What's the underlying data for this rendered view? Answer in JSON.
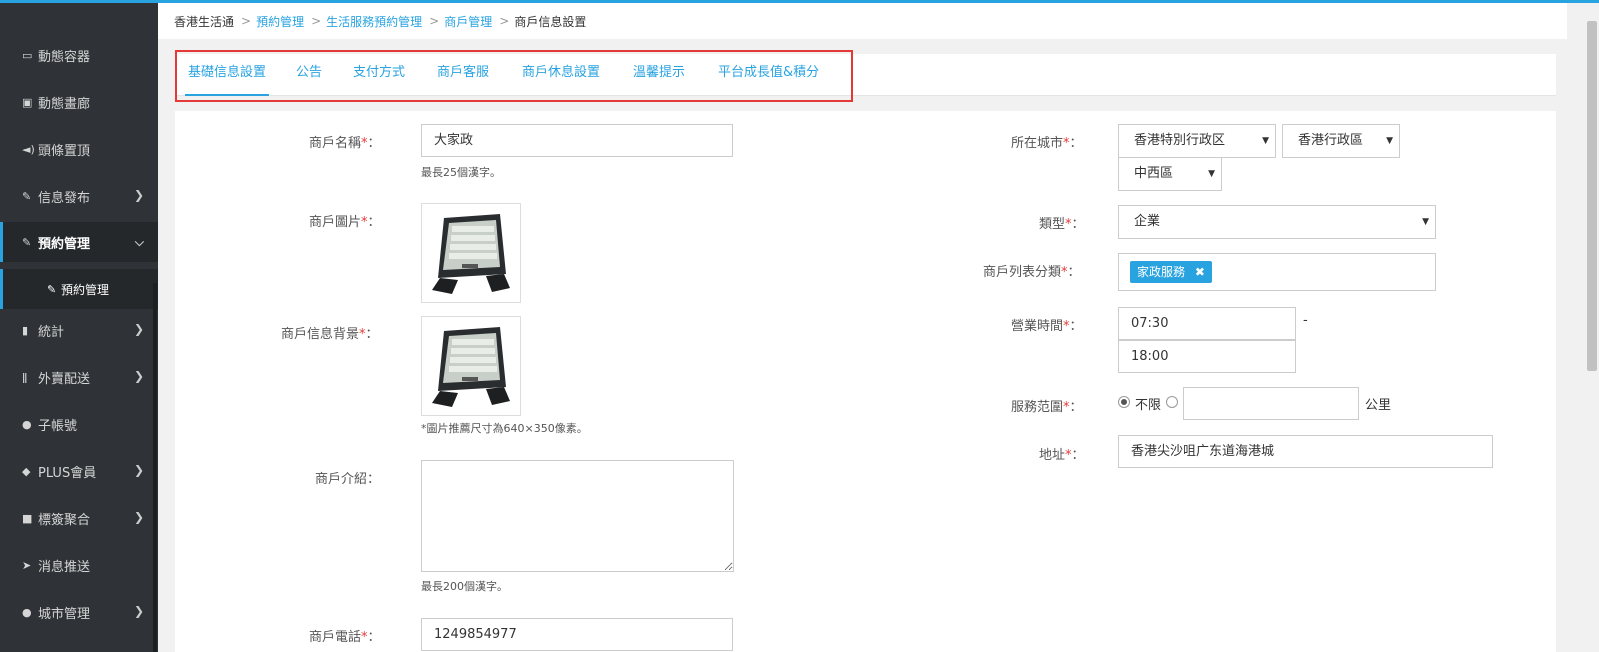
{
  "sidebar": {
    "items": [
      {
        "label": "動態容器",
        "icon": "tablet-icon",
        "glyph": "▭",
        "has_arrow": false
      },
      {
        "label": "動態畫廊",
        "icon": "image-icon",
        "glyph": "▣",
        "has_arrow": false
      },
      {
        "label": "頭條置頂",
        "icon": "megaphone-icon",
        "glyph": "◄)",
        "has_arrow": false
      },
      {
        "label": "信息發布",
        "icon": "edit-icon",
        "glyph": "✎",
        "has_arrow": true
      },
      {
        "label": "預約管理",
        "icon": "check-edit-icon",
        "glyph": "✎",
        "has_arrow": true,
        "expanded": true
      },
      {
        "label": "統計",
        "icon": "bar-chart-icon",
        "glyph": "▮",
        "has_arrow": true
      },
      {
        "label": "外賣配送",
        "icon": "cutlery-icon",
        "glyph": "ǁ",
        "has_arrow": true
      },
      {
        "label": "子帳號",
        "icon": "user-icon",
        "glyph": "●",
        "has_arrow": false
      },
      {
        "label": "PLUS會員",
        "icon": "diamond-icon",
        "glyph": "◆",
        "has_arrow": true
      },
      {
        "label": "標簽聚合",
        "icon": "stop-icon",
        "glyph": "■",
        "has_arrow": true
      },
      {
        "label": "消息推送",
        "icon": "send-icon",
        "glyph": "➤",
        "has_arrow": false
      },
      {
        "label": "城市管理",
        "icon": "map-marker-icon",
        "glyph": "●",
        "has_arrow": true
      }
    ],
    "sub_item": {
      "label": "預約管理",
      "icon": "check-edit-icon",
      "glyph": "✎"
    }
  },
  "breadcrumb": [
    "香港生活通",
    "預約管理",
    "生活服務預約管理",
    "商戶管理",
    "商戶信息設置"
  ],
  "tabs": [
    "基礎信息設置",
    "公告",
    "支付方式",
    "商戶客服",
    "商戶休息設置",
    "溫馨提示",
    "平台成長值&積分"
  ],
  "form": {
    "name": {
      "label": "商戶名稱",
      "value": "大家政",
      "help": "最長25個漢字。"
    },
    "image": {
      "label": "商戶圖片"
    },
    "background": {
      "label": "商戶信息背景",
      "help": "*圖片推薦尺寸為640×350像素。"
    },
    "intro": {
      "label": "商戶介紹：",
      "help": "最長200個漢字。"
    },
    "phone": {
      "label": "商戶電話",
      "value": "1249854977"
    },
    "city": {
      "label": "所在城市",
      "province": "香港特別行政区",
      "city": "香港行政區",
      "district": "中西區"
    },
    "type": {
      "label": "類型",
      "value": "企業"
    },
    "category": {
      "label": "商戶列表分類",
      "tag": "家政服務"
    },
    "hours": {
      "label": "營業時間",
      "start": "07:30",
      "end": "18:00",
      "dash": "-"
    },
    "range": {
      "label": "服務范圍",
      "option": "不限",
      "unit": "公里"
    },
    "address": {
      "label": "地址",
      "value": "香港尖沙咀广东道海港城"
    },
    "required_mark": "*",
    "colon": "："
  },
  "colors": {
    "accent": "#29a3e0",
    "sidebar": "#2f3337",
    "required": "#e53935"
  }
}
